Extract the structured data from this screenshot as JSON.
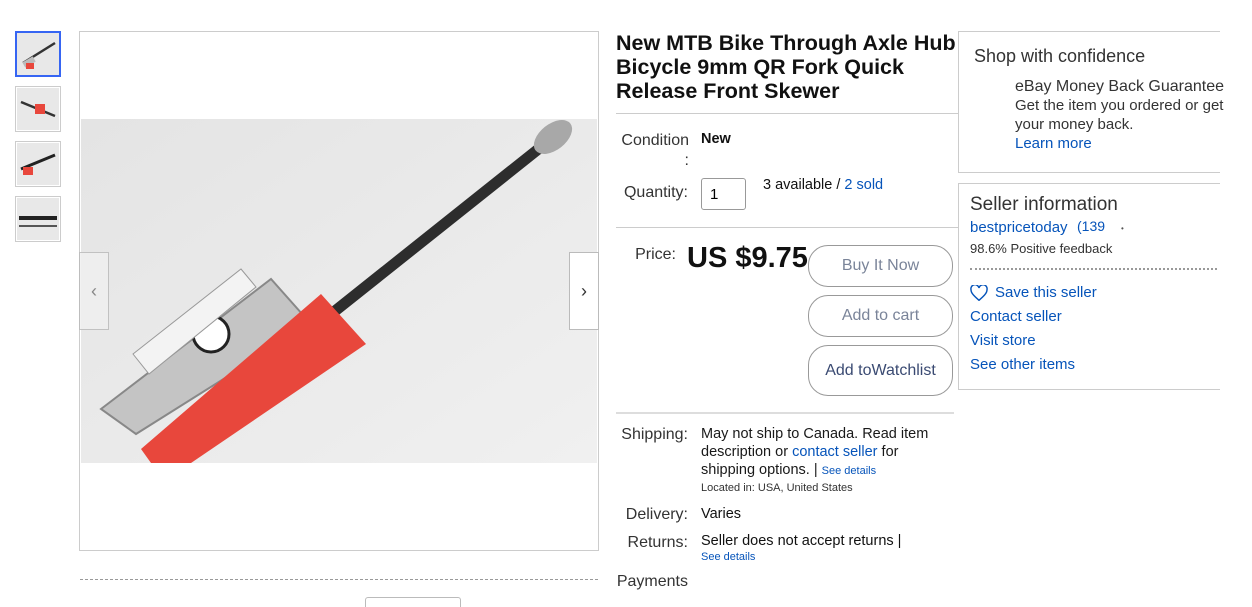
{
  "listing": {
    "title": "New MTB Bike Through Axle Hub Bicycle 9mm QR Fork Quick Release Front Skewer",
    "condition_label": "Condition",
    "condition_colon": ":",
    "condition_value": "New",
    "quantity_label": "Quantity:",
    "quantity_value": "1",
    "available_text": "3 available / ",
    "sold_text": "2 sold",
    "price_label": "Price:",
    "price": "US $9.75",
    "buttons": {
      "buy": "Buy It Now",
      "cart": "Add to cart",
      "watch_line1": "Add to",
      "watch_line2": "Watchlist"
    },
    "shipping_label": "Shipping:",
    "shipping_text_1": "May not ship to Canada. Read item description or ",
    "shipping_link": "contact seller",
    "shipping_text_2": " for shipping options.",
    "shipping_sep": " | ",
    "shipping_details": "See details",
    "located": "Located in: USA, United States",
    "delivery_label": "Delivery:",
    "delivery_value": "Varies",
    "returns_label": "Returns:",
    "returns_value": "Seller does not accept returns |",
    "returns_details": "See details",
    "payments_label": "Payments"
  },
  "image_nav": {
    "prev": "‹",
    "next": "›"
  },
  "shop_confidence": {
    "title": "Shop with confidence",
    "guarantee_head": "eBay Money Back Guarantee",
    "guarantee_body": "Get the item you ordered or get your money back.",
    "learn_more": "Learn more"
  },
  "seller": {
    "title": "Seller information",
    "name": "bestpricetoday",
    "score": "(139",
    "dot": "•",
    "feedback": "98.6% Positive feedback",
    "save": "Save this seller",
    "contact": "Contact seller",
    "visit": "Visit store",
    "other": "See other items"
  },
  "icons": {
    "heart": "heart-icon",
    "arrow_left": "chevron-left-icon",
    "arrow_right": "chevron-right-icon"
  },
  "colors": {
    "link": "#0654ba",
    "active_thumb": "#3665f3",
    "warning_red": "#e8473c"
  }
}
